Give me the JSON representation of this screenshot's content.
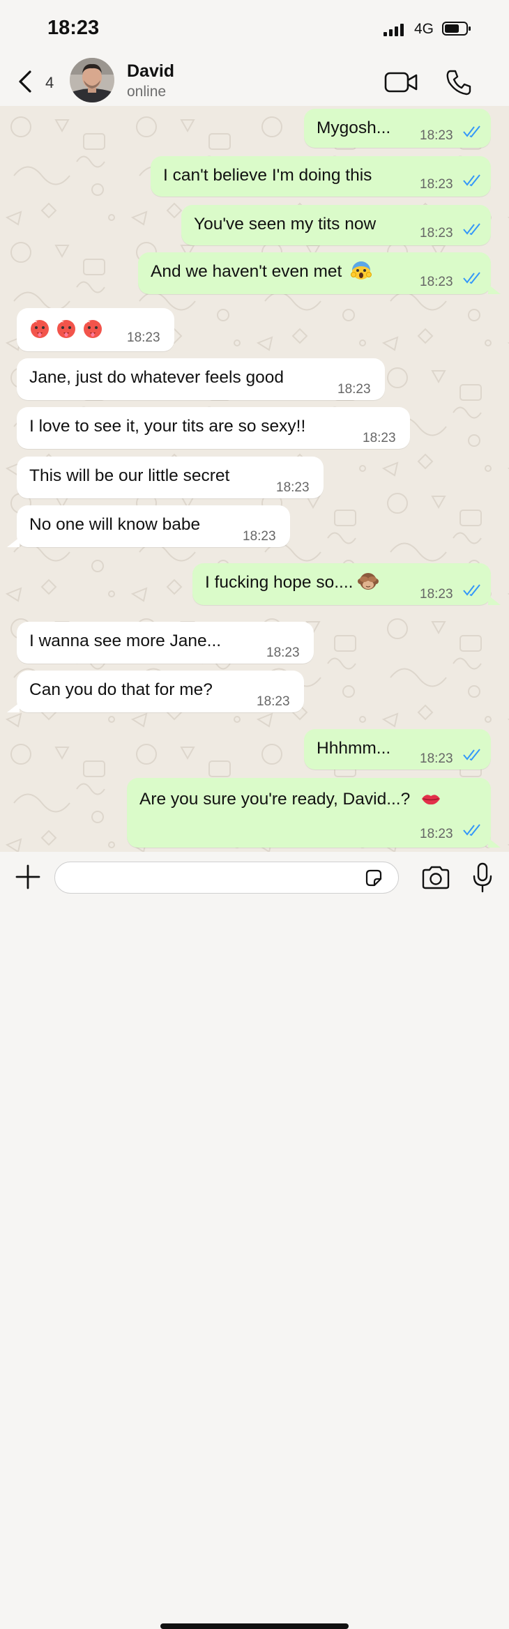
{
  "status_bar": {
    "time": "18:23",
    "network": "4G"
  },
  "header": {
    "back_count": "4",
    "name": "David",
    "status": "online"
  },
  "messages": [
    {
      "dir": "out",
      "text": "Mygosh...",
      "time": "18:23",
      "read": true
    },
    {
      "dir": "out",
      "text": "I can't believe I'm doing this",
      "time": "18:23",
      "read": true
    },
    {
      "dir": "out",
      "text": "You've seen my tits now",
      "time": "18:23",
      "read": true
    },
    {
      "dir": "out",
      "text": "And we haven't even met",
      "time": "18:23",
      "read": true,
      "emoji": "screaming-face"
    },
    {
      "dir": "in",
      "text": "",
      "time": "18:23",
      "emoji": "hot-face x3"
    },
    {
      "dir": "in",
      "text": "Jane, just do whatever feels good",
      "time": "18:23"
    },
    {
      "dir": "in",
      "text": "I love to see it, your tits are so sexy!!",
      "time": "18:23"
    },
    {
      "dir": "in",
      "text": "This will be our little secret",
      "time": "18:23"
    },
    {
      "dir": "in",
      "text": "No one will know babe",
      "time": "18:23"
    },
    {
      "dir": "out",
      "text": "I fucking hope so....",
      "time": "18:23",
      "read": true,
      "emoji": "see-no-evil-monkey"
    },
    {
      "dir": "in",
      "text": "I wanna see more Jane...",
      "time": "18:23"
    },
    {
      "dir": "in",
      "text": "Can you do that for me?",
      "time": "18:23"
    },
    {
      "dir": "out",
      "text": "Hhhmm...",
      "time": "18:23",
      "read": true
    },
    {
      "dir": "out",
      "text": "Are you sure you're ready, David...?",
      "time": "18:23",
      "read": true,
      "emoji": "kiss-lips"
    }
  ],
  "composer": {
    "value": "",
    "placeholder": ""
  },
  "colors": {
    "outgoing_bubble": "#dafbc9",
    "incoming_bubble": "#ffffff",
    "read_ticks": "#3497f9",
    "background": "#efeae2"
  },
  "icons": [
    "back-icon",
    "video-call-icon",
    "phone-icon",
    "plus-icon",
    "sticker-icon",
    "camera-icon",
    "mic-icon"
  ]
}
